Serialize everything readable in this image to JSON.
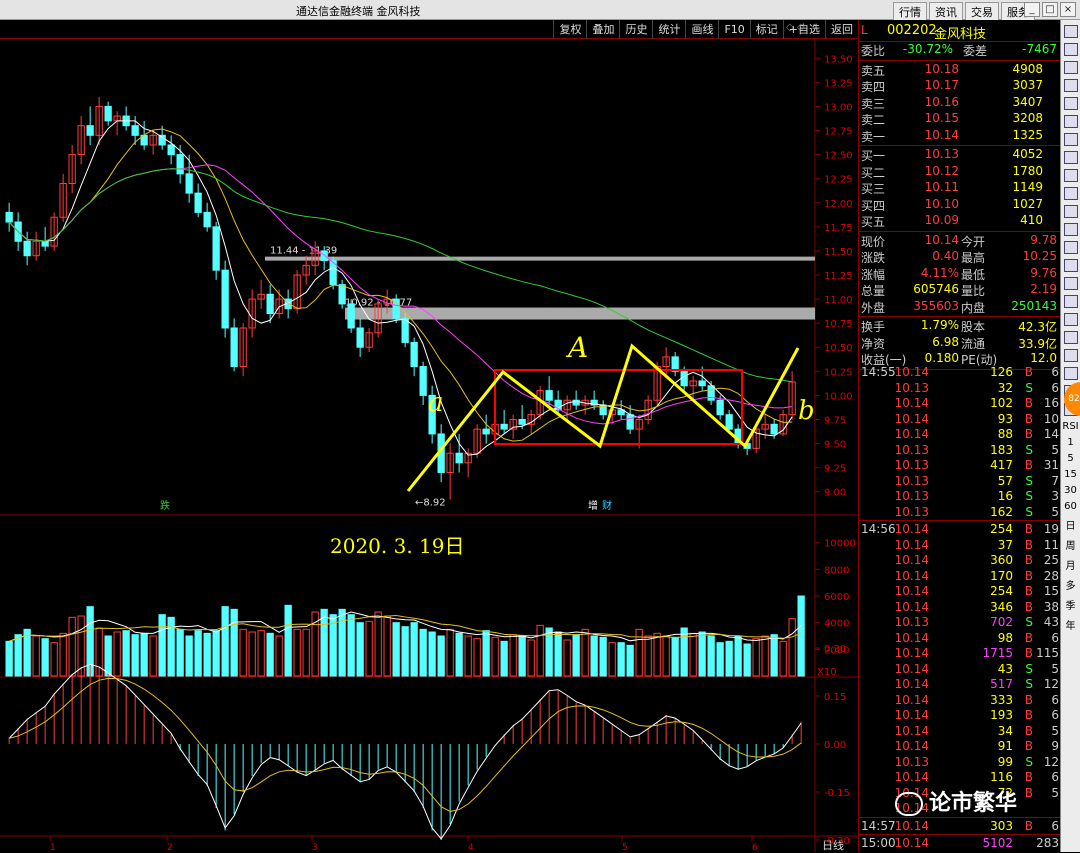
{
  "titlebar": {
    "title": "通达信金融终端  金风科技",
    "menus": [
      "行情",
      "资讯",
      "交易",
      "服务"
    ],
    "win": [
      "_",
      "□",
      "×"
    ]
  },
  "toolbar": {
    "buttons": [
      "复权",
      "叠加",
      "历史",
      "统计",
      "画线",
      "F10",
      "标记",
      "+自选",
      "返回"
    ],
    "icons": "◇ ◇"
  },
  "chart_data": [
    {
      "type": "candlestick",
      "title": "",
      "ylim": [
        8.8,
        13.7
      ],
      "yticks": [
        "13.50",
        "13.25",
        "13.00",
        "12.75",
        "12.50",
        "12.25",
        "12.00",
        "11.75",
        "11.50",
        "11.25",
        "11.00",
        "10.75",
        "10.50",
        "10.25",
        "10.00",
        "9.75",
        "9.50",
        "9.25",
        "9.00"
      ],
      "xticks": [
        "1",
        "2",
        "3",
        "4",
        "5",
        "6"
      ],
      "candles": [
        [
          11.9,
          12.0,
          11.7,
          11.8
        ],
        [
          11.8,
          11.9,
          11.5,
          11.6
        ],
        [
          11.6,
          11.7,
          11.35,
          11.45
        ],
        [
          11.45,
          11.7,
          11.4,
          11.6
        ],
        [
          11.6,
          11.75,
          11.5,
          11.55
        ],
        [
          11.55,
          11.9,
          11.5,
          11.85
        ],
        [
          11.85,
          12.3,
          11.8,
          12.2
        ],
        [
          12.2,
          12.6,
          12.1,
          12.5
        ],
        [
          12.5,
          12.9,
          12.4,
          12.8
        ],
        [
          12.8,
          13.0,
          12.6,
          12.7
        ],
        [
          12.7,
          13.1,
          12.6,
          13.0
        ],
        [
          13.0,
          13.05,
          12.8,
          12.85
        ],
        [
          12.85,
          12.95,
          12.7,
          12.9
        ],
        [
          12.9,
          13.0,
          12.75,
          12.8
        ],
        [
          12.8,
          12.9,
          12.6,
          12.7
        ],
        [
          12.7,
          12.85,
          12.55,
          12.6
        ],
        [
          12.6,
          12.75,
          12.5,
          12.7
        ],
        [
          12.7,
          12.8,
          12.55,
          12.6
        ],
        [
          12.6,
          12.7,
          12.4,
          12.5
        ],
        [
          12.5,
          12.6,
          12.2,
          12.3
        ],
        [
          12.3,
          12.5,
          12.0,
          12.1
        ],
        [
          12.1,
          12.2,
          11.85,
          11.9
        ],
        [
          11.9,
          12.0,
          11.7,
          11.75
        ],
        [
          11.75,
          11.8,
          11.2,
          11.3
        ],
        [
          11.3,
          11.4,
          10.6,
          10.7
        ],
        [
          10.7,
          10.8,
          10.25,
          10.3
        ],
        [
          10.3,
          10.75,
          10.2,
          10.7
        ],
        [
          10.7,
          11.1,
          10.6,
          11.0
        ],
        [
          11.0,
          11.2,
          10.9,
          11.05
        ],
        [
          11.05,
          11.15,
          10.75,
          10.85
        ],
        [
          10.85,
          11.1,
          10.8,
          11.0
        ],
        [
          11.0,
          11.1,
          10.8,
          10.9
        ],
        [
          10.9,
          11.3,
          10.85,
          11.25
        ],
        [
          11.25,
          11.45,
          11.15,
          11.35
        ],
        [
          11.35,
          11.6,
          11.25,
          11.5
        ],
        [
          11.5,
          11.55,
          11.3,
          11.4
        ],
        [
          11.4,
          11.44,
          11.1,
          11.15
        ],
        [
          11.15,
          11.2,
          10.9,
          10.95
        ],
        [
          10.95,
          11.0,
          10.65,
          10.7
        ],
        [
          10.7,
          10.8,
          10.4,
          10.5
        ],
        [
          10.5,
          10.7,
          10.45,
          10.65
        ],
        [
          10.65,
          11.0,
          10.6,
          10.95
        ],
        [
          10.95,
          11.1,
          10.85,
          11.0
        ],
        [
          11.0,
          11.05,
          10.75,
          10.8
        ],
        [
          10.8,
          10.85,
          10.5,
          10.55
        ],
        [
          10.55,
          10.6,
          10.2,
          10.3
        ],
        [
          10.3,
          10.35,
          9.9,
          10.0
        ],
        [
          10.0,
          10.1,
          9.5,
          9.6
        ],
        [
          9.6,
          9.7,
          9.1,
          9.2
        ],
        [
          9.2,
          9.5,
          8.92,
          9.4
        ],
        [
          9.4,
          9.6,
          9.2,
          9.3
        ],
        [
          9.3,
          9.45,
          9.15,
          9.4
        ],
        [
          9.4,
          9.7,
          9.35,
          9.65
        ],
        [
          9.65,
          9.8,
          9.5,
          9.6
        ],
        [
          9.6,
          9.75,
          9.5,
          9.7
        ],
        [
          9.7,
          9.85,
          9.6,
          9.65
        ],
        [
          9.65,
          9.8,
          9.55,
          9.75
        ],
        [
          9.75,
          9.9,
          9.65,
          9.7
        ],
        [
          9.7,
          9.85,
          9.6,
          9.8
        ],
        [
          9.8,
          10.1,
          9.75,
          10.05
        ],
        [
          10.05,
          10.2,
          9.9,
          9.95
        ],
        [
          9.95,
          10.05,
          9.8,
          9.85
        ],
        [
          9.85,
          10.0,
          9.75,
          9.95
        ],
        [
          9.95,
          10.05,
          9.85,
          9.9
        ],
        [
          9.9,
          10.0,
          9.8,
          9.95
        ],
        [
          9.95,
          10.05,
          9.85,
          9.9
        ],
        [
          9.9,
          9.95,
          9.75,
          9.8
        ],
        [
          9.8,
          9.9,
          9.7,
          9.85
        ],
        [
          9.85,
          9.95,
          9.75,
          9.8
        ],
        [
          9.8,
          9.9,
          9.6,
          9.65
        ],
        [
          9.65,
          9.8,
          9.45,
          9.75
        ],
        [
          9.75,
          10.0,
          9.7,
          9.95
        ],
        [
          9.95,
          10.35,
          9.9,
          10.3
        ],
        [
          10.3,
          10.5,
          10.2,
          10.4
        ],
        [
          10.4,
          10.45,
          10.2,
          10.25
        ],
        [
          10.25,
          10.3,
          10.05,
          10.1
        ],
        [
          10.1,
          10.2,
          9.95,
          10.15
        ],
        [
          10.15,
          10.3,
          10.05,
          10.1
        ],
        [
          10.1,
          10.15,
          9.9,
          9.95
        ],
        [
          9.95,
          10.0,
          9.75,
          9.8
        ],
        [
          9.8,
          9.85,
          9.6,
          9.65
        ],
        [
          9.65,
          9.7,
          9.45,
          9.5
        ],
        [
          9.5,
          9.55,
          9.38,
          9.45
        ],
        [
          9.45,
          9.7,
          9.4,
          9.65
        ],
        [
          9.65,
          9.8,
          9.55,
          9.7
        ],
        [
          9.7,
          9.75,
          9.55,
          9.6
        ],
        [
          9.6,
          9.85,
          9.58,
          9.8
        ],
        [
          9.8,
          10.25,
          9.75,
          10.14
        ]
      ],
      "annotations": {
        "hlines": [
          {
            "label": "11.44 - 11.39",
            "value": 11.42
          },
          {
            "label": "10.92 - 10.77",
            "value": 10.85
          }
        ],
        "low_label": "8.92",
        "markers": [
          "跌",
          "增",
          "财"
        ],
        "letters": [
          "a",
          "A",
          "b"
        ]
      }
    },
    {
      "type": "bar",
      "title": "2020. 3. 19日",
      "yticks": [
        "10000",
        "8000",
        "6000",
        "4000",
        "2000"
      ],
      "unit": "X10",
      "values": [
        2.6,
        3.1,
        3.5,
        3.0,
        2.8,
        2.5,
        3.2,
        4.4,
        4.5,
        5.2,
        3.6,
        3.0,
        3.3,
        3.4,
        3.1,
        3.2,
        3.0,
        4.6,
        4.4,
        3.5,
        3.0,
        3.4,
        3.2,
        3.4,
        5.2,
        5.0,
        3.5,
        3.3,
        3.4,
        3.2,
        3.0,
        5.3,
        3.5,
        3.5,
        4.8,
        5.0,
        4.6,
        5.0,
        4.6,
        4.0,
        4.1,
        4.8,
        4.5,
        4.0,
        3.7,
        4.0,
        3.5,
        3.3,
        3.0,
        3.5,
        3.2,
        3.0,
        2.8,
        3.4,
        2.9,
        2.6,
        3.1,
        3.0,
        2.7,
        3.8,
        3.6,
        3.3,
        2.7,
        3.1,
        3.5,
        3.0,
        2.9,
        2.5,
        2.5,
        2.3,
        3.5,
        3.0,
        3.2,
        3.0,
        2.9,
        3.6,
        3.2,
        3.3,
        3.0,
        2.5,
        2.6,
        3.0,
        2.4,
        2.8,
        3.0,
        3.1,
        2.6,
        4.3,
        6.0
      ]
    },
    {
      "type": "bar",
      "title": "MACD",
      "yticks": [
        "0.30",
        "0.15",
        "0.00",
        "-0.15",
        "-0.30"
      ],
      "values": [
        0.02,
        0.05,
        0.08,
        0.1,
        0.12,
        0.16,
        0.19,
        0.22,
        0.24,
        0.25,
        0.24,
        0.22,
        0.2,
        0.18,
        0.15,
        0.12,
        0.09,
        0.06,
        0.03,
        -0.02,
        -0.06,
        -0.1,
        -0.13,
        -0.2,
        -0.27,
        -0.22,
        -0.15,
        -0.1,
        -0.06,
        -0.04,
        -0.05,
        -0.07,
        -0.09,
        -0.1,
        -0.08,
        -0.06,
        -0.05,
        -0.08,
        -0.1,
        -0.12,
        -0.11,
        -0.08,
        -0.07,
        -0.09,
        -0.12,
        -0.15,
        -0.2,
        -0.27,
        -0.3,
        -0.25,
        -0.18,
        -0.13,
        -0.08,
        -0.04,
        0.0,
        0.03,
        0.06,
        0.08,
        0.11,
        0.14,
        0.17,
        0.17,
        0.15,
        0.13,
        0.12,
        0.1,
        0.08,
        0.06,
        0.04,
        0.02,
        0.03,
        0.05,
        0.07,
        0.09,
        0.08,
        0.06,
        0.04,
        0.01,
        -0.02,
        -0.05,
        -0.07,
        -0.08,
        -0.07,
        -0.05,
        -0.04,
        -0.03,
        -0.01,
        0.03,
        0.07
      ]
    }
  ],
  "chart_labels": {
    "bottom_tab": "日线"
  },
  "quote": {
    "code": "002202",
    "name": "金风科技",
    "head_prefix": "L",
    "wb_label": "委比",
    "wb_value": "-30.72%",
    "wc_label": "委差",
    "wc_value": "-7467",
    "sells": [
      [
        "卖五",
        "10.18",
        "4908"
      ],
      [
        "卖四",
        "10.17",
        "3037"
      ],
      [
        "卖三",
        "10.16",
        "3407"
      ],
      [
        "卖二",
        "10.15",
        "3208"
      ],
      [
        "卖一",
        "10.14",
        "1325"
      ]
    ],
    "buys": [
      [
        "买一",
        "10.13",
        "4052"
      ],
      [
        "买二",
        "10.12",
        "1780"
      ],
      [
        "买三",
        "10.11",
        "1149"
      ],
      [
        "买四",
        "10.10",
        "1027"
      ],
      [
        "买五",
        "10.09",
        "410"
      ]
    ],
    "stats": [
      [
        "现价",
        "10.14",
        "今开",
        "9.78"
      ],
      [
        "涨跌",
        "0.40",
        "最高",
        "10.25"
      ],
      [
        "涨幅",
        "4.11%",
        "最低",
        "9.76"
      ],
      [
        "总量",
        "605746",
        "量比",
        "2.19"
      ],
      [
        "外盘",
        "355603",
        "内盘",
        "250143"
      ]
    ],
    "stats2": [
      [
        "换手",
        "1.79%",
        "股本",
        "42.3亿"
      ],
      [
        "净资",
        "6.98",
        "流通",
        "33.9亿"
      ],
      [
        "收益(一)",
        "0.180",
        "PE(动)",
        "12.0"
      ]
    ],
    "ticks": [
      [
        "14:55",
        "10.14",
        "126",
        "B",
        "6"
      ],
      [
        "",
        "10.13",
        "32",
        "S",
        "6"
      ],
      [
        "",
        "10.14",
        "102",
        "B",
        "16"
      ],
      [
        "",
        "10.14",
        "93",
        "B",
        "10"
      ],
      [
        "",
        "10.14",
        "88",
        "B",
        "14"
      ],
      [
        "",
        "10.13",
        "183",
        "S",
        "5"
      ],
      [
        "",
        "10.13",
        "417",
        "B",
        "31"
      ],
      [
        "",
        "10.13",
        "57",
        "S",
        "7"
      ],
      [
        "",
        "10.13",
        "16",
        "S",
        "3"
      ],
      [
        "",
        "10.13",
        "162",
        "S",
        "5"
      ],
      [
        "14:56",
        "10.14",
        "254",
        "B",
        "19"
      ],
      [
        "",
        "10.14",
        "37",
        "B",
        "11"
      ],
      [
        "",
        "10.14",
        "360",
        "B",
        "25"
      ],
      [
        "",
        "10.14",
        "170",
        "B",
        "28"
      ],
      [
        "",
        "10.14",
        "254",
        "B",
        "15"
      ],
      [
        "",
        "10.14",
        "346",
        "B",
        "38"
      ],
      [
        "",
        "10.13",
        "702",
        "S",
        "43"
      ],
      [
        "",
        "10.14",
        "98",
        "B",
        "6"
      ],
      [
        "",
        "10.14",
        "1715",
        "B",
        "115"
      ],
      [
        "",
        "10.14",
        "43",
        "S",
        "5"
      ],
      [
        "",
        "10.14",
        "517",
        "S",
        "12"
      ],
      [
        "",
        "10.14",
        "333",
        "B",
        "6"
      ],
      [
        "",
        "10.14",
        "193",
        "B",
        "6"
      ],
      [
        "",
        "10.14",
        "34",
        "B",
        "5"
      ],
      [
        "",
        "10.14",
        "91",
        "B",
        "9"
      ],
      [
        "",
        "10.13",
        "99",
        "S",
        "12"
      ],
      [
        "",
        "10.14",
        "116",
        "B",
        "6"
      ],
      [
        "",
        "10.14",
        "72",
        "B",
        "5"
      ],
      [
        "",
        "10.14",
        "",
        "",
        ""
      ],
      [
        "14:57",
        "10.14",
        "303",
        "B",
        "6"
      ],
      [
        "15:00",
        "10.14",
        "5102",
        "",
        "283"
      ]
    ]
  },
  "sidebar": {
    "texts": [
      "RSI",
      "1",
      "5",
      "15",
      "30",
      "60",
      "日",
      "周",
      "月",
      "多",
      "季",
      "年"
    ],
    "badge": "82"
  },
  "watermark": "论市繁华",
  "colors": {
    "up": "#ff3c3c",
    "down": "#54ffff",
    "yellow": "#ffff00",
    "ma5": "#ffffff",
    "ma10": "#e5c01a",
    "ma20": "#ff40ff",
    "ma60": "#33cc33"
  }
}
